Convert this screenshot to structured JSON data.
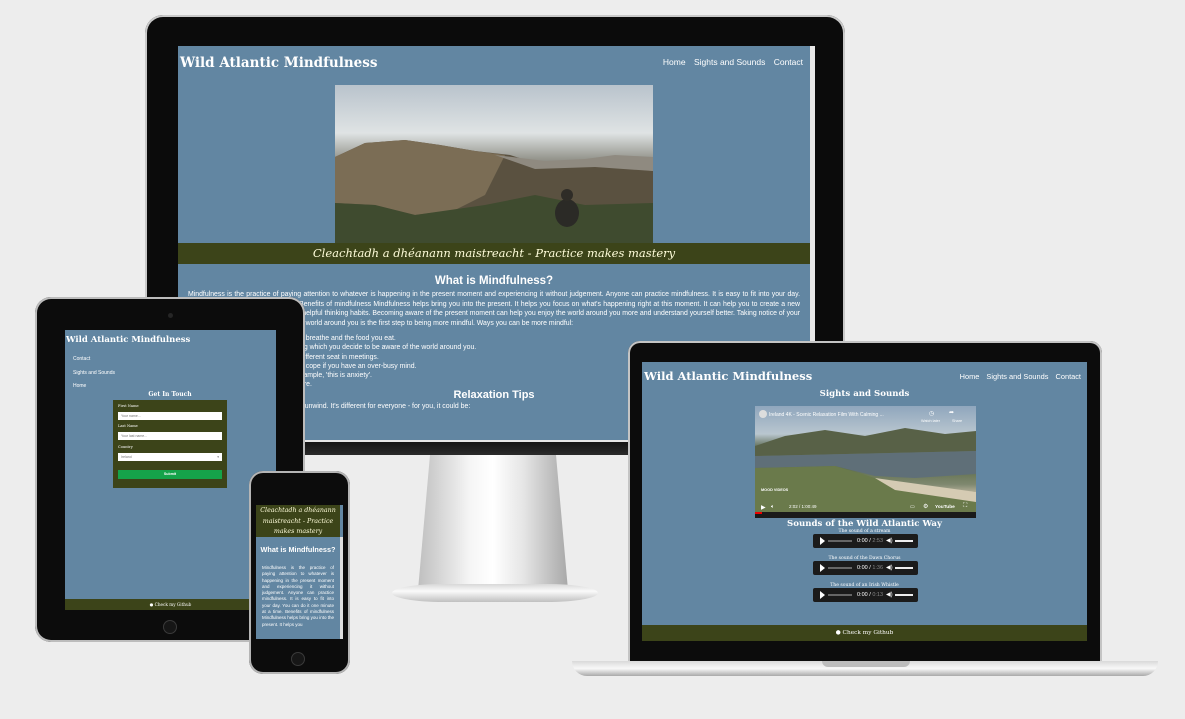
{
  "site": {
    "title": "Wild Atlantic Mindfulness",
    "nav": [
      "Home",
      "Sights and Sounds",
      "Contact"
    ],
    "nav_mobile": [
      "Contact",
      "Sights and Sounds",
      "Home"
    ],
    "tagline": "Cleachtadh a dhéanann maistreacht - Practice makes mastery",
    "footer_link": "Check my Github"
  },
  "home": {
    "heading": "What is Mindfulness?",
    "intro": "Mindfulness is the practice of paying attention to whatever is happening in the present moment and experiencing it without judgement. Anyone can practice mindfulness. It is easy to fit into your day. You can do it one minute at a time. Benefits of mindfulness Mindfulness helps bring you into the present. It helps you focus on what's happening right at this moment. It can help you to create a new habit that helps to weaken old and unhelpful thinking habits. Becoming aware of the present moment can help you enjoy the world around you more and understand yourself better. Taking notice of your thoughts, feelings, sensations and the world around you is the first step to being more mindful. Ways you can be more mindful:",
    "tips_visible": [
      "u breathe and the food you eat.",
      "ng which you decide to be aware of the world around you.",
      "different seat in meetings.",
      "u cope if you have an over-busy mind.",
      "xample, 'this is anxiety'.",
      "ure."
    ],
    "relax_heading": "Relaxation Tips",
    "relax_text": "u unwind. It's different for everyone - for you, it could be:",
    "phone_intro": "Mindfulness is the practice of paying attention to whatever is happening in the present moment and experiencing it without judgement. Anyone can practice mindfulness. It is easy to fit into your day. You can do it one minute at a time. Benefits of mindfulness Mindfulness helps bring you into the present. It helps you"
  },
  "contact": {
    "heading": "Get In Touch",
    "first_name_label": "First Name",
    "first_name_placeholder": "Your name...",
    "last_name_label": "Last Name",
    "last_name_placeholder": "Your last name...",
    "country_label": "Country",
    "country_value": "Ireland",
    "submit_label": "Submit"
  },
  "sights": {
    "heading": "Sights and Sounds",
    "video_title": "Ireland 4K - Scenic Relaxation Film With Calming ...",
    "video_watch_later": "Watch later",
    "video_share": "Share",
    "video_channel": "MOOD VIDEOS",
    "video_time": "2:02 / 1:00:49",
    "video_brand": "YouTube",
    "sounds_heading": "Sounds of the Wild Atlantic Way",
    "tracks": [
      {
        "caption": "The sound of a stream",
        "time": "0:00",
        "duration": "2:53"
      },
      {
        "caption": "The sound of the Dawn Chorus",
        "time": "0:00",
        "duration": "1:36"
      },
      {
        "caption": "The sound of an Irish Whistle",
        "time": "0:00",
        "duration": "0:13"
      }
    ]
  },
  "colors": {
    "page_bg": "#6286a2",
    "accent_dark": "#3c4419",
    "banner_text": "#fffdda",
    "submit": "#15a34a"
  }
}
